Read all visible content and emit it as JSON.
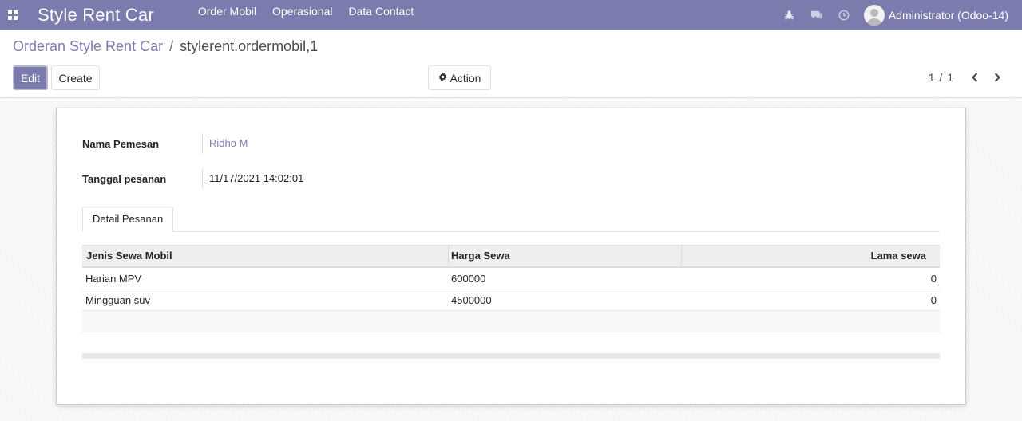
{
  "navbar": {
    "brand": "Style Rent Car",
    "menu": [
      "Order Mobil",
      "Operasional",
      "Data Contact"
    ],
    "user": "Administrator (Odoo-14)"
  },
  "breadcrumb": {
    "parent": "Orderan Style Rent Car",
    "separator": "/",
    "current": "stylerent.ordermobil,1"
  },
  "buttons": {
    "edit": "Edit",
    "create": "Create",
    "action": "Action"
  },
  "pager": {
    "value": "1 / 1"
  },
  "form": {
    "nama_pemesan": {
      "label": "Nama Pemesan",
      "value": "Ridho M"
    },
    "tanggal_pesanan": {
      "label": "Tanggal pesanan",
      "value": "11/17/2021 14:02:01"
    }
  },
  "tabs": [
    "Detail Pesanan"
  ],
  "table": {
    "headers": [
      "Jenis Sewa Mobil",
      "Harga Sewa",
      "Lama sewa"
    ],
    "rows": [
      [
        "Harian MPV",
        "600000",
        "0"
      ],
      [
        "Mingguan suv",
        "4500000",
        "0"
      ]
    ]
  },
  "colors": {
    "brand": "#7c7bad"
  }
}
